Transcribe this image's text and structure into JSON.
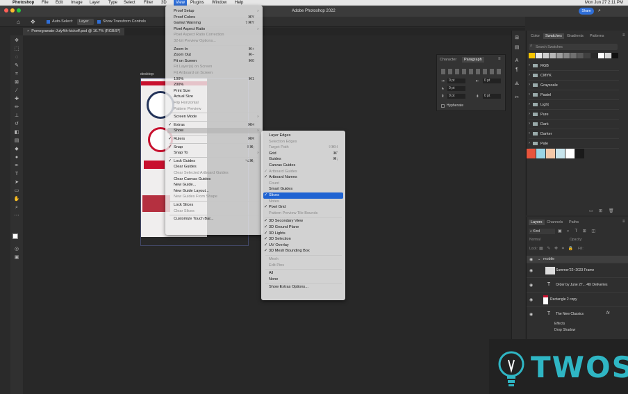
{
  "macbar": {
    "apple": "",
    "app": "Photoshop",
    "menus": [
      "File",
      "Edit",
      "Image",
      "Layer",
      "Type",
      "Select",
      "Filter",
      "3D",
      "View",
      "Plugins",
      "Window",
      "Help"
    ],
    "clock": "Mon Jun 27  2:11 PM"
  },
  "titlebar": {
    "title": "Adobe Photoshop 2022",
    "share": "Share"
  },
  "options": {
    "auto_select_label": "Auto-Select:",
    "auto_select_value": "Layer",
    "transform_label": "Show Transform Controls"
  },
  "document_tab": "Pomegranate-July4th-kickoff.psd @ 16.7% (RGB/8*)",
  "artboard_label": "desktop",
  "view_menu": {
    "items": [
      {
        "label": "Proof Setup",
        "sc": "",
        "sub": true,
        "check": false,
        "dis": false
      },
      {
        "label": "Proof Colors",
        "sc": "⌘Y",
        "sub": false,
        "check": false,
        "dis": false
      },
      {
        "label": "Gamut Warning",
        "sc": "⇧⌘Y",
        "sub": false,
        "check": false,
        "dis": false
      },
      {
        "label": "Pixel Aspect Ratio",
        "sc": "",
        "sub": true,
        "check": false,
        "dis": false
      },
      {
        "label": "Pixel Aspect Ratio Correction",
        "sc": "",
        "sub": false,
        "check": false,
        "dis": true
      },
      {
        "label": "32-bit Preview Options...",
        "sc": "",
        "sub": false,
        "check": false,
        "dis": true
      },
      {
        "sep": true
      },
      {
        "label": "Zoom In",
        "sc": "⌘+",
        "sub": false,
        "check": false,
        "dis": false
      },
      {
        "label": "Zoom Out",
        "sc": "⌘−",
        "sub": false,
        "check": false,
        "dis": false
      },
      {
        "label": "Fit on Screen",
        "sc": "⌘0",
        "sub": false,
        "check": false,
        "dis": false
      },
      {
        "label": "Fit Layer(s) on Screen",
        "sc": "",
        "sub": false,
        "check": false,
        "dis": true
      },
      {
        "label": "Fit Artboard on Screen",
        "sc": "",
        "sub": false,
        "check": false,
        "dis": true
      },
      {
        "label": "100%",
        "sc": "⌘1",
        "sub": false,
        "check": false,
        "dis": false
      },
      {
        "label": "200%",
        "sc": "",
        "sub": false,
        "check": false,
        "dis": false
      },
      {
        "label": "Print Size",
        "sc": "",
        "sub": false,
        "check": false,
        "dis": false
      },
      {
        "label": "Actual Size",
        "sc": "",
        "sub": false,
        "check": false,
        "dis": false
      },
      {
        "label": "Flip Horizontal",
        "sc": "",
        "sub": false,
        "check": false,
        "dis": true
      },
      {
        "label": "Pattern Preview",
        "sc": "",
        "sub": false,
        "check": false,
        "dis": true
      },
      {
        "sep": true
      },
      {
        "label": "Screen Mode",
        "sc": "",
        "sub": true,
        "check": false,
        "dis": false
      },
      {
        "sep": true
      },
      {
        "label": "Extras",
        "sc": "⌘H",
        "sub": false,
        "check": true,
        "dis": false
      },
      {
        "label": "Show",
        "sc": "",
        "sub": true,
        "check": false,
        "dis": false,
        "active": true
      },
      {
        "sep": true
      },
      {
        "label": "Rulers",
        "sc": "⌘R",
        "sub": false,
        "check": true,
        "dis": false
      },
      {
        "sep": true
      },
      {
        "label": "Snap",
        "sc": "⇧⌘;",
        "sub": false,
        "check": true,
        "dis": false
      },
      {
        "label": "Snap To",
        "sc": "",
        "sub": true,
        "check": false,
        "dis": false
      },
      {
        "sep": true
      },
      {
        "label": "Lock Guides",
        "sc": "⌥⌘;",
        "sub": false,
        "check": true,
        "dis": false
      },
      {
        "label": "Clear Guides",
        "sc": "",
        "sub": false,
        "check": false,
        "dis": false
      },
      {
        "label": "Clear Selected Artboard Guides",
        "sc": "",
        "sub": false,
        "check": false,
        "dis": true
      },
      {
        "label": "Clear Canvas Guides",
        "sc": "",
        "sub": false,
        "check": false,
        "dis": false
      },
      {
        "label": "New Guide...",
        "sc": "",
        "sub": false,
        "check": false,
        "dis": false
      },
      {
        "label": "New Guide Layout...",
        "sc": "",
        "sub": false,
        "check": false,
        "dis": false
      },
      {
        "label": "New Guides From Shape",
        "sc": "",
        "sub": false,
        "check": false,
        "dis": true
      },
      {
        "sep": true
      },
      {
        "label": "Lock Slices",
        "sc": "",
        "sub": false,
        "check": false,
        "dis": false
      },
      {
        "label": "Clear Slices",
        "sc": "",
        "sub": false,
        "check": false,
        "dis": true
      },
      {
        "sep": true
      },
      {
        "label": "Customize Touch Bar...",
        "sc": "",
        "sub": false,
        "check": false,
        "dis": false
      }
    ]
  },
  "show_menu": {
    "items": [
      {
        "label": "Layer Edges",
        "sc": "",
        "check": false,
        "dis": false
      },
      {
        "label": "Selection Edges",
        "sc": "",
        "check": false,
        "dis": true
      },
      {
        "label": "Target Path",
        "sc": "⇧⌘H",
        "check": false,
        "dis": true
      },
      {
        "label": "Grid",
        "sc": "⌘'",
        "check": false,
        "dis": false
      },
      {
        "label": "Guides",
        "sc": "⌘;",
        "check": false,
        "dis": false
      },
      {
        "label": "Canvas Guides",
        "sc": "",
        "check": false,
        "dis": false
      },
      {
        "label": "Artboard Guides",
        "sc": "",
        "check": true,
        "dis": true
      },
      {
        "label": "Artboard Names",
        "sc": "",
        "check": true,
        "dis": false
      },
      {
        "label": "Count",
        "sc": "",
        "check": false,
        "dis": true
      },
      {
        "label": "Smart Guides",
        "sc": "",
        "check": false,
        "dis": false
      },
      {
        "label": "Slices",
        "sc": "",
        "check": true,
        "dis": false,
        "active": true
      },
      {
        "label": "Notes",
        "sc": "",
        "check": false,
        "dis": true
      },
      {
        "label": "Pixel Grid",
        "sc": "",
        "check": true,
        "dis": false
      },
      {
        "label": "Pattern Preview Tile Bounds",
        "sc": "",
        "check": false,
        "dis": true
      },
      {
        "sep": true
      },
      {
        "label": "3D Secondary View",
        "sc": "",
        "check": true,
        "dis": false
      },
      {
        "label": "3D Ground Plane",
        "sc": "",
        "check": true,
        "dis": false
      },
      {
        "label": "3D Lights",
        "sc": "",
        "check": true,
        "dis": false
      },
      {
        "label": "3D Selection",
        "sc": "",
        "check": true,
        "dis": false
      },
      {
        "label": "UV Overlay",
        "sc": "",
        "check": true,
        "dis": false
      },
      {
        "label": "3D Mesh Bounding Box",
        "sc": "",
        "check": true,
        "dis": false
      },
      {
        "sep": true
      },
      {
        "label": "Mesh",
        "sc": "",
        "check": false,
        "dis": true
      },
      {
        "label": "Edit Pins",
        "sc": "",
        "check": false,
        "dis": true
      },
      {
        "sep": true
      },
      {
        "label": "All",
        "sc": "",
        "check": false,
        "dis": false
      },
      {
        "label": "None",
        "sc": "",
        "check": false,
        "dis": false
      },
      {
        "sep": true
      },
      {
        "label": "Show Extras Options...",
        "sc": "",
        "check": false,
        "dis": false
      }
    ]
  },
  "char_panel": {
    "tabs": [
      "Character",
      "Paragraph"
    ],
    "fields": [
      "0 pt",
      "0 pt",
      "0 pt",
      "0 pt",
      "0 pt"
    ],
    "hyphenate": "Hyphenate"
  },
  "swatches": {
    "tabs": [
      "Color",
      "Swatches",
      "Gradients",
      "Patterns"
    ],
    "search_placeholder": "Search Swatches",
    "top_colors": [
      "#f5c400",
      "#e8e8e8",
      "#cfcfcf",
      "#b7b7b7",
      "#9f9f9f",
      "#888888",
      "#707070",
      "#585858",
      "#404040",
      "#2a2a2a",
      "#ffffff",
      "#d7d7d7",
      "#111111"
    ],
    "groups": [
      "RGB",
      "CMYK",
      "Grayscale",
      "Pastel",
      "Light",
      "Pure",
      "Dark",
      "Darker",
      "Pale"
    ],
    "bottom_colors": [
      "#e8543c",
      "#9ad4e4",
      "#f4c8a8",
      "#c7e4ec",
      "#ffffff",
      "#1a1a1a"
    ]
  },
  "layers": {
    "tabs": [
      "Layers",
      "Channels",
      "Paths"
    ],
    "kind": "Kind",
    "blend": "Normal",
    "opacity_label": "Opacity:",
    "lock_label": "Lock:",
    "fill_label": "Fill:",
    "group": "mobile",
    "rows": [
      {
        "name": "Summer'22~2023 Frame",
        "icon": "image"
      },
      {
        "name": "Order by June 27... 4th Deliveries",
        "icon": "T"
      },
      {
        "name": "Rectangle 2 copy",
        "icon": "rect"
      },
      {
        "name": "The New Classics",
        "icon": "T",
        "fx": "fx"
      }
    ],
    "effects": "Effects",
    "drop_shadow": "Drop Shadow"
  },
  "watermark": {
    "text": "TWOS",
    "color": "#2fb6c4"
  }
}
